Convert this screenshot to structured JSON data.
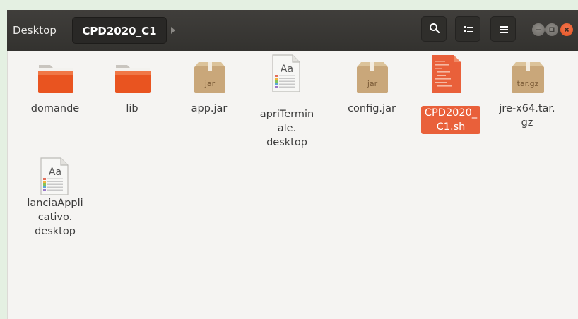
{
  "breadcrumb": {
    "parent": "Desktop",
    "current": "CPD2020_C1"
  },
  "toolbar": {
    "search_icon": "search-icon",
    "view_icon": "list-view-icon",
    "menu_icon": "hamburger-menu-icon"
  },
  "window_controls": [
    "minimize",
    "maximize",
    "close"
  ],
  "colors": {
    "headerbar": "#3b3a37",
    "folder": "#e95420",
    "selection": "#e9603a",
    "archive": "#c9a77a"
  },
  "files": [
    {
      "name": "domande",
      "type": "folder"
    },
    {
      "name": "lib",
      "type": "folder"
    },
    {
      "name": "app.jar",
      "type": "archive",
      "badge": "jar"
    },
    {
      "name": "apriTermin\nale.\ndesktop",
      "type": "text"
    },
    {
      "name": "config.jar",
      "type": "archive",
      "badge": "jar"
    },
    {
      "name": "CPD2020_\nC1.sh",
      "type": "script",
      "selected": true
    },
    {
      "name": "jre-x64.tar.\ngz",
      "type": "archive",
      "badge": "tar.gz"
    },
    {
      "name": "lanciaAppli\ncativo.\ndesktop",
      "type": "text"
    }
  ]
}
